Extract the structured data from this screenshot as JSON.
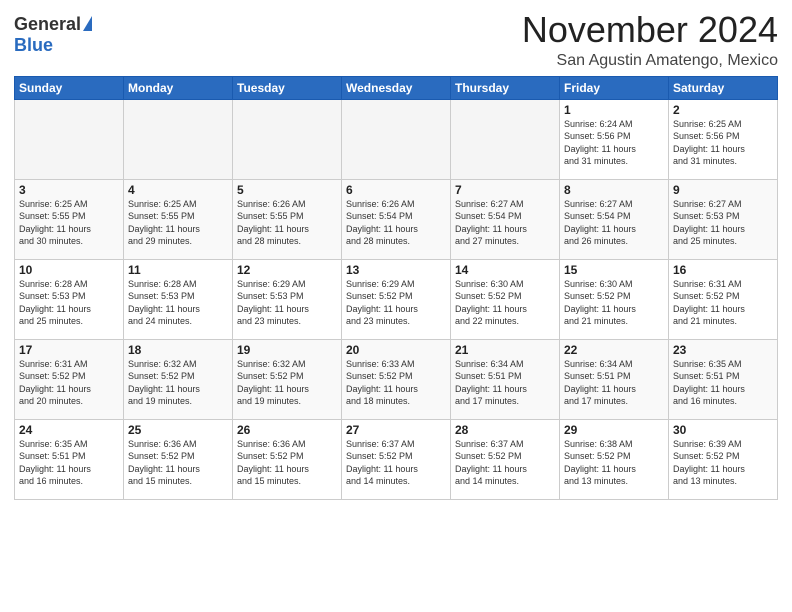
{
  "header": {
    "logo_general": "General",
    "logo_blue": "Blue",
    "month": "November 2024",
    "location": "San Agustin Amatengo, Mexico"
  },
  "days_of_week": [
    "Sunday",
    "Monday",
    "Tuesday",
    "Wednesday",
    "Thursday",
    "Friday",
    "Saturday"
  ],
  "weeks": [
    [
      {
        "day": "",
        "info": ""
      },
      {
        "day": "",
        "info": ""
      },
      {
        "day": "",
        "info": ""
      },
      {
        "day": "",
        "info": ""
      },
      {
        "day": "",
        "info": ""
      },
      {
        "day": "1",
        "info": "Sunrise: 6:24 AM\nSunset: 5:56 PM\nDaylight: 11 hours\nand 31 minutes."
      },
      {
        "day": "2",
        "info": "Sunrise: 6:25 AM\nSunset: 5:56 PM\nDaylight: 11 hours\nand 31 minutes."
      }
    ],
    [
      {
        "day": "3",
        "info": "Sunrise: 6:25 AM\nSunset: 5:55 PM\nDaylight: 11 hours\nand 30 minutes."
      },
      {
        "day": "4",
        "info": "Sunrise: 6:25 AM\nSunset: 5:55 PM\nDaylight: 11 hours\nand 29 minutes."
      },
      {
        "day": "5",
        "info": "Sunrise: 6:26 AM\nSunset: 5:55 PM\nDaylight: 11 hours\nand 28 minutes."
      },
      {
        "day": "6",
        "info": "Sunrise: 6:26 AM\nSunset: 5:54 PM\nDaylight: 11 hours\nand 28 minutes."
      },
      {
        "day": "7",
        "info": "Sunrise: 6:27 AM\nSunset: 5:54 PM\nDaylight: 11 hours\nand 27 minutes."
      },
      {
        "day": "8",
        "info": "Sunrise: 6:27 AM\nSunset: 5:54 PM\nDaylight: 11 hours\nand 26 minutes."
      },
      {
        "day": "9",
        "info": "Sunrise: 6:27 AM\nSunset: 5:53 PM\nDaylight: 11 hours\nand 25 minutes."
      }
    ],
    [
      {
        "day": "10",
        "info": "Sunrise: 6:28 AM\nSunset: 5:53 PM\nDaylight: 11 hours\nand 25 minutes."
      },
      {
        "day": "11",
        "info": "Sunrise: 6:28 AM\nSunset: 5:53 PM\nDaylight: 11 hours\nand 24 minutes."
      },
      {
        "day": "12",
        "info": "Sunrise: 6:29 AM\nSunset: 5:53 PM\nDaylight: 11 hours\nand 23 minutes."
      },
      {
        "day": "13",
        "info": "Sunrise: 6:29 AM\nSunset: 5:52 PM\nDaylight: 11 hours\nand 23 minutes."
      },
      {
        "day": "14",
        "info": "Sunrise: 6:30 AM\nSunset: 5:52 PM\nDaylight: 11 hours\nand 22 minutes."
      },
      {
        "day": "15",
        "info": "Sunrise: 6:30 AM\nSunset: 5:52 PM\nDaylight: 11 hours\nand 21 minutes."
      },
      {
        "day": "16",
        "info": "Sunrise: 6:31 AM\nSunset: 5:52 PM\nDaylight: 11 hours\nand 21 minutes."
      }
    ],
    [
      {
        "day": "17",
        "info": "Sunrise: 6:31 AM\nSunset: 5:52 PM\nDaylight: 11 hours\nand 20 minutes."
      },
      {
        "day": "18",
        "info": "Sunrise: 6:32 AM\nSunset: 5:52 PM\nDaylight: 11 hours\nand 19 minutes."
      },
      {
        "day": "19",
        "info": "Sunrise: 6:32 AM\nSunset: 5:52 PM\nDaylight: 11 hours\nand 19 minutes."
      },
      {
        "day": "20",
        "info": "Sunrise: 6:33 AM\nSunset: 5:52 PM\nDaylight: 11 hours\nand 18 minutes."
      },
      {
        "day": "21",
        "info": "Sunrise: 6:34 AM\nSunset: 5:51 PM\nDaylight: 11 hours\nand 17 minutes."
      },
      {
        "day": "22",
        "info": "Sunrise: 6:34 AM\nSunset: 5:51 PM\nDaylight: 11 hours\nand 17 minutes."
      },
      {
        "day": "23",
        "info": "Sunrise: 6:35 AM\nSunset: 5:51 PM\nDaylight: 11 hours\nand 16 minutes."
      }
    ],
    [
      {
        "day": "24",
        "info": "Sunrise: 6:35 AM\nSunset: 5:51 PM\nDaylight: 11 hours\nand 16 minutes."
      },
      {
        "day": "25",
        "info": "Sunrise: 6:36 AM\nSunset: 5:52 PM\nDaylight: 11 hours\nand 15 minutes."
      },
      {
        "day": "26",
        "info": "Sunrise: 6:36 AM\nSunset: 5:52 PM\nDaylight: 11 hours\nand 15 minutes."
      },
      {
        "day": "27",
        "info": "Sunrise: 6:37 AM\nSunset: 5:52 PM\nDaylight: 11 hours\nand 14 minutes."
      },
      {
        "day": "28",
        "info": "Sunrise: 6:37 AM\nSunset: 5:52 PM\nDaylight: 11 hours\nand 14 minutes."
      },
      {
        "day": "29",
        "info": "Sunrise: 6:38 AM\nSunset: 5:52 PM\nDaylight: 11 hours\nand 13 minutes."
      },
      {
        "day": "30",
        "info": "Sunrise: 6:39 AM\nSunset: 5:52 PM\nDaylight: 11 hours\nand 13 minutes."
      }
    ]
  ]
}
